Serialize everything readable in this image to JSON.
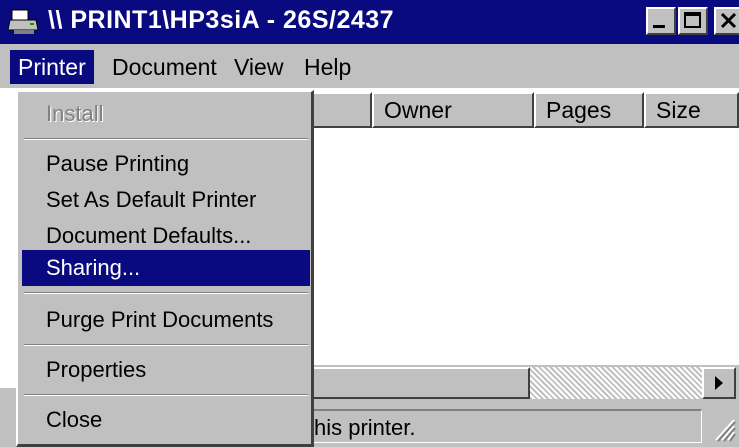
{
  "window": {
    "title": "\\\\ PRINT1\\HP3siA - 26S/2437",
    "icon": "printer-icon",
    "controls": {
      "minimize": "minimize-icon",
      "maximize": "maximize-icon",
      "close": "close-icon"
    }
  },
  "menubar": {
    "items": [
      {
        "label": "Printer",
        "active": true
      },
      {
        "label": "Document"
      },
      {
        "label": "View"
      },
      {
        "label": "Help"
      }
    ]
  },
  "columns": [
    "Owner",
    "Pages",
    "Size"
  ],
  "printer_menu": {
    "items": [
      {
        "label": "Install",
        "state": "disabled"
      },
      {
        "label": "Pause Printing"
      },
      {
        "label": "Set As Default Printer"
      },
      {
        "label": "Document Defaults..."
      },
      {
        "label": "Sharing...",
        "state": "selected"
      },
      {
        "label": "Purge Print Documents"
      },
      {
        "label": "Properties"
      },
      {
        "label": "Close"
      }
    ]
  },
  "status": {
    "text": "his printer."
  },
  "colors": {
    "title_bar": "#0a0a80",
    "selection": "#0a0a80",
    "face": "#c0c0c0"
  }
}
